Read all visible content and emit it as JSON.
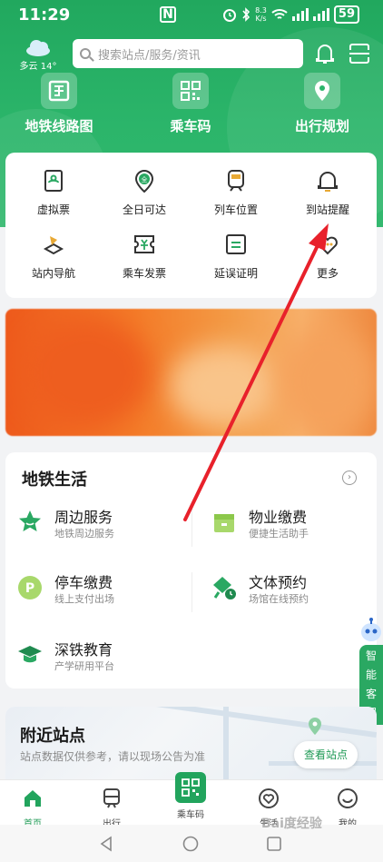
{
  "status": {
    "time": "11:29",
    "net_speed_top": "8.3",
    "net_speed_unit": "K/s",
    "battery": "59"
  },
  "weather": {
    "text": "多云 14°"
  },
  "search": {
    "placeholder": "搜索站点/服务/资讯"
  },
  "quick": [
    {
      "label": "地铁线路图",
      "icon": "metro-map-icon"
    },
    {
      "label": "乘车码",
      "icon": "qr-code-icon"
    },
    {
      "label": "出行规划",
      "icon": "location-pin-icon"
    }
  ],
  "services": [
    {
      "label": "虚拟票",
      "icon": "virtual-ticket-icon"
    },
    {
      "label": "全日可达",
      "icon": "all-day-icon",
      "badge": "全"
    },
    {
      "label": "列车位置",
      "icon": "train-icon"
    },
    {
      "label": "到站提醒",
      "icon": "arrival-bell-icon"
    },
    {
      "label": "站内导航",
      "icon": "navigation-icon"
    },
    {
      "label": "乘车发票",
      "icon": "invoice-icon"
    },
    {
      "label": "延误证明",
      "icon": "delay-proof-icon"
    },
    {
      "label": "更多",
      "icon": "more-icon"
    }
  ],
  "life": {
    "title": "地铁生活",
    "items": [
      {
        "title": "周边服务",
        "sub": "地铁周边服务",
        "icon": "star-icon"
      },
      {
        "title": "物业缴费",
        "sub": "便捷生活助手",
        "icon": "property-icon"
      },
      {
        "title": "停车缴费",
        "sub": "线上支付出场",
        "icon": "parking-icon",
        "badge": "P"
      },
      {
        "title": "文体预约",
        "sub": "场馆在线预约",
        "icon": "sports-icon"
      },
      {
        "title": "深铁教育",
        "sub": "产学研用平台",
        "icon": "education-icon"
      }
    ]
  },
  "side_tab": {
    "label": "智能客服"
  },
  "nearby": {
    "title": "附近站点",
    "sub": "站点数据仅供参考，请以现场公告为准",
    "button": "查看站点"
  },
  "tabs": [
    {
      "label": "首页",
      "active": true
    },
    {
      "label": "出行",
      "active": false
    },
    {
      "label": "乘车码",
      "active": false
    },
    {
      "label": "生活",
      "active": false
    },
    {
      "label": "我的",
      "active": false
    }
  ],
  "watermark": "Bai度经验",
  "colors": {
    "brand_green": "#22a45d",
    "arrow_red": "#e8212b",
    "banner_orange": "#f47b28"
  }
}
